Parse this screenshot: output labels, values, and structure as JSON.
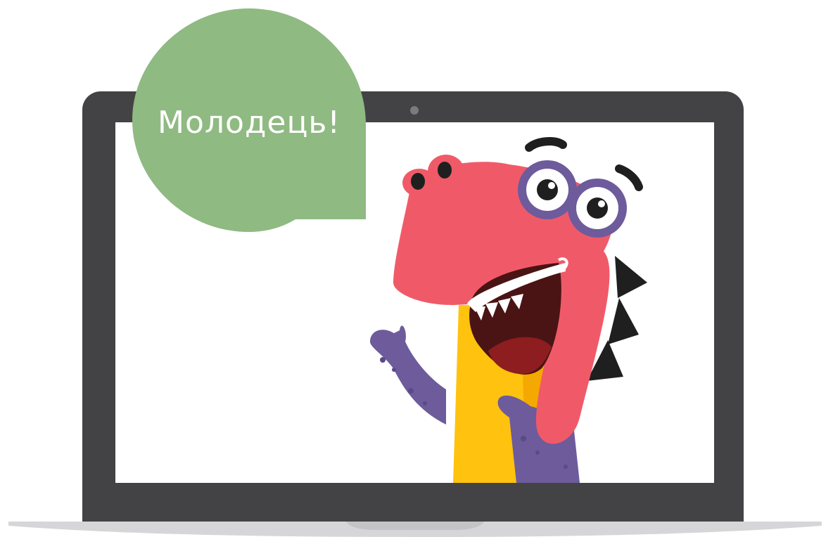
{
  "speech_bubble": {
    "text": "Молодець!",
    "color": "#8fba82"
  },
  "laptop": {
    "frame_color": "#434345",
    "screen_color": "#ffffff",
    "base_color": "#d6d6d8"
  },
  "character": {
    "name": "dinosaur-mascot-icon",
    "colors": {
      "head": "#f05a68",
      "body": "#ffc20e",
      "arms": "#6d5b9c",
      "glasses": "#6d5b9c",
      "spikes": "#1f1f1f",
      "mouth": "#4a1414",
      "tongue": "#8d1d1f"
    }
  }
}
